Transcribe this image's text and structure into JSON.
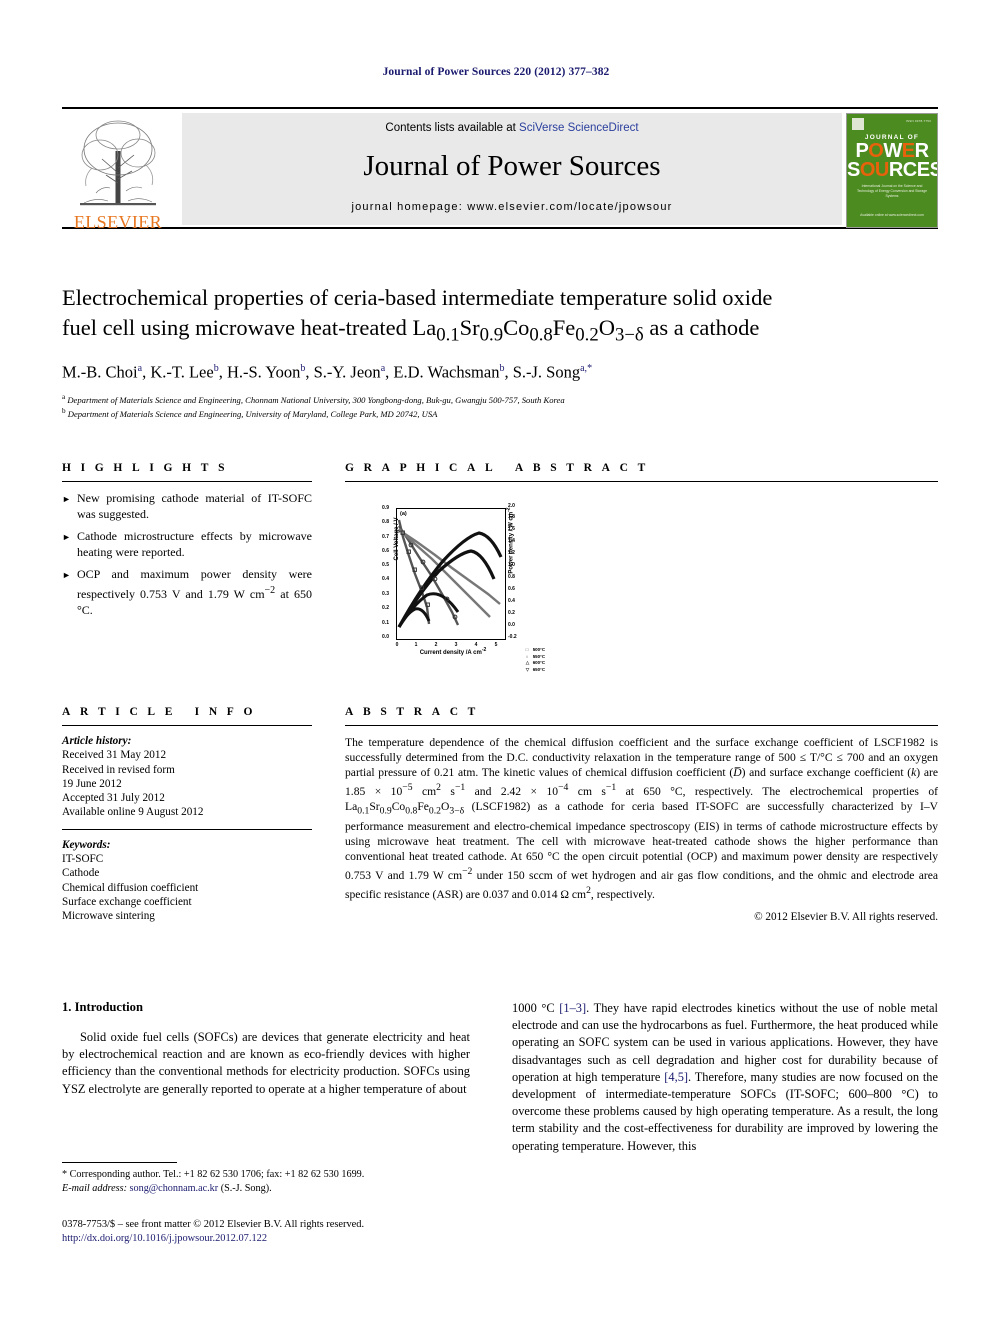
{
  "running_head": "Journal of Power Sources 220 (2012) 377–382",
  "masthead": {
    "elsevier_wordmark": "ELSEVIER",
    "contents_prefix": "Contents lists available at ",
    "contents_link": "SciVerse ScienceDirect",
    "journal_title": "Journal of Power Sources",
    "homepage": "journal homepage: www.elsevier.com/locate/jpowsour",
    "cover": {
      "journal_of": "JOURNAL OF",
      "power": "POWER",
      "sources": "SOURCES",
      "subtitle": "International Journal on the Science and Technology of Energy Conversion and Storage Systems",
      "footer": "Available online at www.sciencedirect.com"
    }
  },
  "article": {
    "title_line1": "Electrochemical properties of ceria-based intermediate temperature solid oxide",
    "title_line2_pre": "fuel cell using microwave heat-treated La",
    "title_formula": "La0.1Sr0.9Co0.8Fe0.2O3−δ",
    "title_line2_post": " as a cathode",
    "authors_plain": "M.-B. Choi a, K.-T. Lee b, H.-S. Yoon b, S.-Y. Jeon a, E.D. Wachsman b, S.-J. Song a,*",
    "affiliation_a": "Department of Materials Science and Engineering, Chonnam National University, 300 Yongbong-dong, Buk-gu, Gwangju 500-757, South Korea",
    "affiliation_b": "Department of Materials Science and Engineering, University of Maryland, College Park, MD 20742, USA"
  },
  "highlights": {
    "heading": "HIGHLIGHTS",
    "bullet_glyph": "►",
    "items": [
      "New promising cathode material of IT-SOFC was suggested.",
      "Cathode microstructure effects by microwave heating were reported.",
      "OCP and maximum power density were respectively 0.753 V and 1.79 W cm−2 at 650 °C."
    ]
  },
  "graphical_abstract": {
    "heading": "GRAPHICAL ABSTRACT"
  },
  "chart_data": {
    "type": "line",
    "title": "",
    "panel_label": "(a)",
    "xlabel": "Current density /A cm−2",
    "ylabel_left": "Cell Voltage / V",
    "ylabel_right": "Power density / W cm−2",
    "xlim": [
      0,
      5.4
    ],
    "ylim_left": [
      0.0,
      0.9
    ],
    "ylim_right": [
      -0.2,
      2.0
    ],
    "xticks": [
      0,
      1,
      2,
      3,
      4,
      5
    ],
    "yticks_left": [
      "0.0",
      "0.1",
      "0.2",
      "0.3",
      "0.4",
      "0.5",
      "0.6",
      "0.7",
      "0.8",
      "0.9"
    ],
    "yticks_right": [
      "-0.2",
      "0.0",
      "0.2",
      "0.4",
      "0.6",
      "0.8",
      "1.0",
      "1.2",
      "1.4",
      "1.6",
      "1.8",
      "2.0"
    ],
    "grid": false,
    "legend_position": "bottom-right",
    "legend": [
      {
        "symbol": "□",
        "label": "500°C"
      },
      {
        "symbol": "○",
        "label": "550°C"
      },
      {
        "symbol": "△",
        "label": "600°C"
      },
      {
        "symbol": "▽",
        "label": "650°C"
      }
    ],
    "series": [
      {
        "name": "500°C I-V",
        "axis": "left",
        "x": [
          0,
          0.2,
          0.5,
          0.8,
          1.1,
          1.4,
          1.5
        ],
        "y": [
          0.82,
          0.7,
          0.53,
          0.37,
          0.22,
          0.12,
          0.1
        ]
      },
      {
        "name": "550°C I-V",
        "axis": "left",
        "x": [
          0,
          0.5,
          1.0,
          1.6,
          2.2,
          2.7,
          3.0
        ],
        "y": [
          0.78,
          0.66,
          0.54,
          0.4,
          0.26,
          0.15,
          0.1
        ]
      },
      {
        "name": "600°C I-V",
        "axis": "left",
        "x": [
          0,
          0.8,
          1.7,
          2.5,
          3.3,
          4.0,
          4.6
        ],
        "y": [
          0.76,
          0.66,
          0.55,
          0.45,
          0.35,
          0.26,
          0.19
        ]
      },
      {
        "name": "650°C I-V",
        "axis": "left",
        "x": [
          0,
          0.9,
          1.8,
          2.7,
          3.6,
          4.5,
          5.1
        ],
        "y": [
          0.753,
          0.67,
          0.58,
          0.49,
          0.41,
          0.33,
          0.27
        ]
      },
      {
        "name": "500°C Power",
        "axis": "right",
        "x": [
          0,
          0.3,
          0.6,
          0.9,
          1.2,
          1.5
        ],
        "y": [
          0.0,
          0.19,
          0.3,
          0.33,
          0.26,
          0.15
        ]
      },
      {
        "name": "550°C Power",
        "axis": "right",
        "x": [
          0,
          0.6,
          1.2,
          1.8,
          2.4,
          3.0
        ],
        "y": [
          0.0,
          0.33,
          0.55,
          0.62,
          0.5,
          0.3
        ]
      },
      {
        "name": "600°C Power",
        "axis": "right",
        "x": [
          0,
          0.9,
          1.8,
          2.7,
          3.5,
          4.3,
          4.8
        ],
        "y": [
          0.0,
          0.55,
          1.0,
          1.28,
          1.35,
          1.1,
          0.8
        ]
      },
      {
        "name": "650°C Power",
        "axis": "right",
        "x": [
          0,
          1.0,
          2.0,
          3.0,
          4.0,
          4.7,
          5.2
        ],
        "y": [
          0.0,
          0.64,
          1.2,
          1.62,
          1.79,
          1.66,
          1.42
        ]
      }
    ]
  },
  "article_info": {
    "heading": "ARTICLE INFO",
    "history_label": "Article history:",
    "history": [
      "Received 31 May 2012",
      "Received in revised form",
      "19 June 2012",
      "Accepted 31 July 2012",
      "Available online 9 August 2012"
    ],
    "keywords_label": "Keywords:",
    "keywords": [
      "IT-SOFC",
      "Cathode",
      "Chemical diffusion coefficient",
      "Surface exchange coefficient",
      "Microwave sintering"
    ]
  },
  "abstract": {
    "heading": "ABSTRACT",
    "text": "The temperature dependence of the chemical diffusion coefficient and the surface exchange coefficient of LSCF1982 is successfully determined from the D.C. conductivity relaxation in the temperature range of 500 ≤ T/°C ≤ 700 and an oxygen partial pressure of 0.21 atm. The kinetic values of chemical diffusion coefficient (D̅) and surface exchange coefficient (k) are 1.85 × 10−5 cm2 s−1 and 2.42 × 10−4 cm s−1 at 650 °C, respectively. The electrochemical properties of La0.1Sr0.9Co0.8Fe0.2O3−δ (LSCF1982) as a cathode for ceria based IT-SOFC are successfully characterized by I–V performance measurement and electro-chemical impedance spectroscopy (EIS) in terms of cathode microstructure effects by using microwave heat treatment. The cell with microwave heat-treated cathode shows the higher performance than conventional heat treated cathode. At 650 °C the open circuit potential (OCP) and maximum power density are respectively 0.753 V and 1.79 W cm−2 under 150 sccm of wet hydrogen and air gas flow conditions, and the ohmic and electrode area specific resistance (ASR) are 0.037 and 0.014 Ω cm2, respectively.",
    "copyright": "© 2012 Elsevier B.V. All rights reserved."
  },
  "body": {
    "section_number_title": "1. Introduction",
    "left_paragraph": "Solid oxide fuel cells (SOFCs) are devices that generate electricity and heat by electrochemical reaction and are known as eco-friendly devices with higher efficiency than the conventional methods for electricity production. SOFCs using YSZ electrolyte are generally reported to operate at a higher temperature of about",
    "right_paragraph_part1": "1000 °C ",
    "right_citation1": "[1–3]",
    "right_paragraph_part2": ". They have rapid electrodes kinetics without the use of noble metal electrode and can use the hydrocarbons as fuel. Furthermore, the heat produced while operating an SOFC system can be used in various applications. However, they have disadvantages such as cell degradation and higher cost for durability because of operation at high temperature ",
    "right_citation2": "[4,5]",
    "right_paragraph_part3": ". Therefore, many studies are now focused on the development of intermediate-temperature SOFCs (IT-SOFC; 600–800 °C) to overcome these problems caused by high operating temperature. As a result, the long term stability and the cost-effectiveness for durability are improved by lowering the operating temperature. However, this"
  },
  "footnotes": {
    "corresponding": "* Corresponding author. Tel.: +1 82 62 530 1706; fax: +1 82 62 530 1699.",
    "email_label": "E-mail address:",
    "email": "song@chonnam.ac.kr",
    "email_suffix": "(S.-J. Song).",
    "issn_line": "0378-7753/$ – see front matter © 2012 Elsevier B.V. All rights reserved.",
    "doi": "http://dx.doi.org/10.1016/j.jpowsour.2012.07.122"
  }
}
